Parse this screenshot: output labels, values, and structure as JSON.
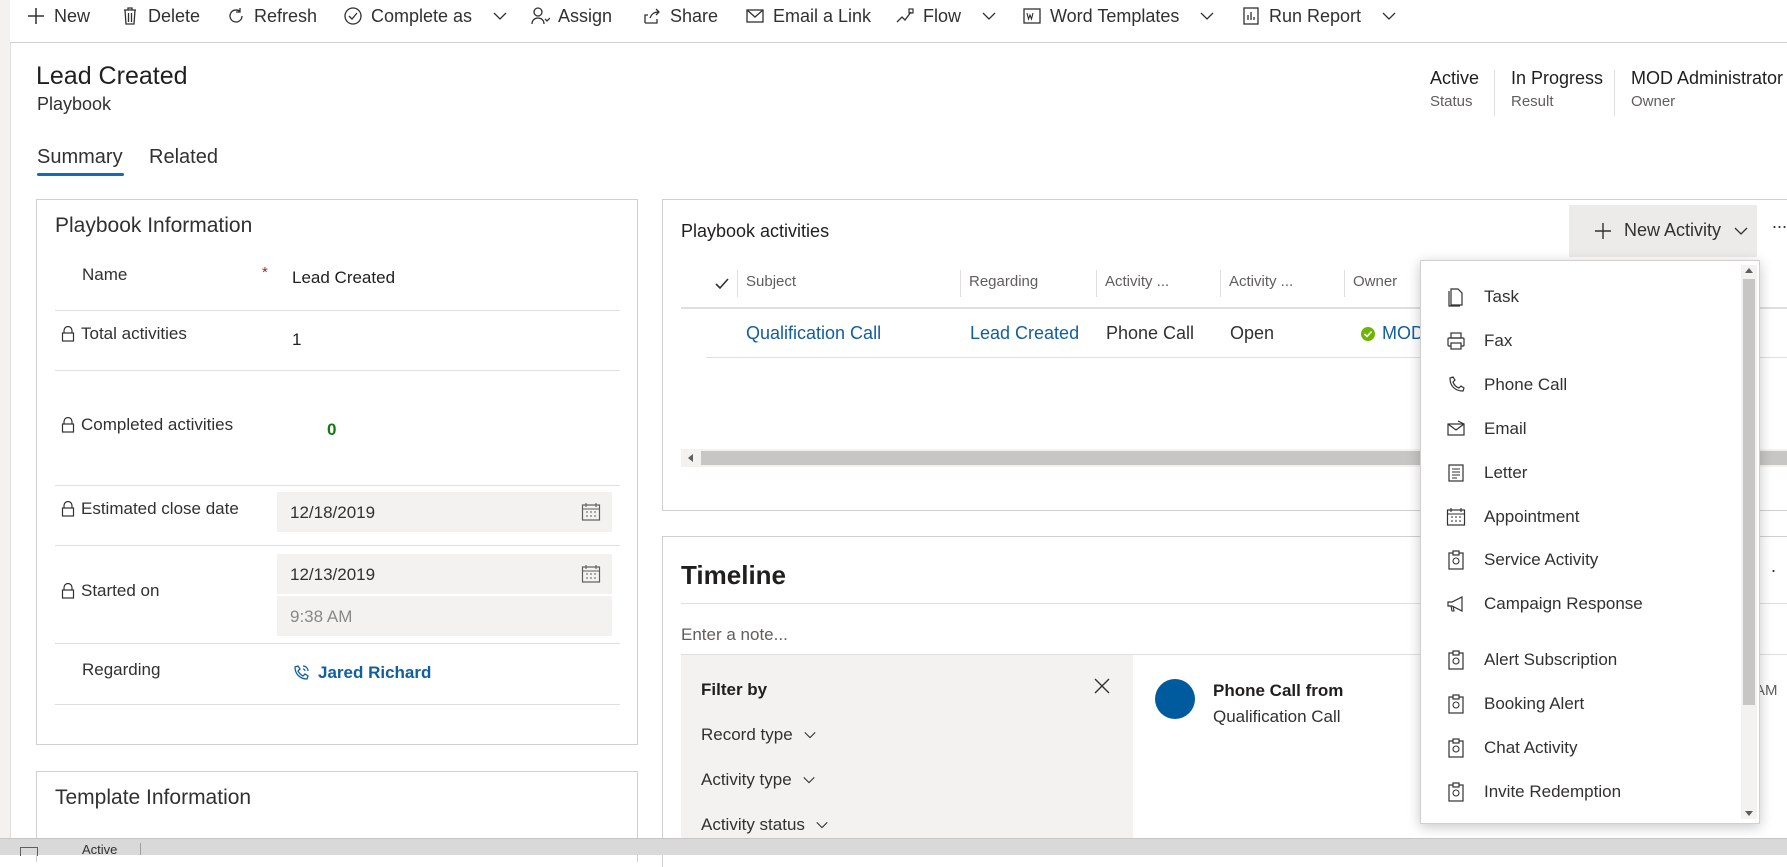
{
  "command_bar": {
    "new": "New",
    "delete": "Delete",
    "refresh": "Refresh",
    "complete_as": "Complete as",
    "assign": "Assign",
    "share": "Share",
    "email_link": "Email a Link",
    "flow": "Flow",
    "word_templates": "Word Templates",
    "run_report": "Run Report"
  },
  "header": {
    "title": "Lead Created",
    "entity": "Playbook",
    "fields": [
      {
        "value": "Active",
        "label": "Status"
      },
      {
        "value": "In Progress",
        "label": "Result"
      },
      {
        "value": "MOD Administrator",
        "label": "Owner"
      }
    ]
  },
  "tabs": [
    "Summary",
    "Related"
  ],
  "playbook_info": {
    "title": "Playbook Information",
    "name_label": "Name",
    "name_required": "*",
    "name_value": "Lead Created",
    "total_label": "Total activities",
    "total_value": "1",
    "completed_label": "Completed activities",
    "completed_value": "0",
    "est_close_label": "Estimated close date",
    "est_close_value": "12/18/2019",
    "started_label": "Started on",
    "started_date": "12/13/2019",
    "started_time": "9:38 AM",
    "regarding_label": "Regarding",
    "regarding_value": "Jared Richard"
  },
  "template_info": {
    "title": "Template Information"
  },
  "activities": {
    "title": "Playbook activities",
    "new_activity": "New Activity",
    "more": "...",
    "columns": [
      "Subject",
      "Regarding",
      "Activity ...",
      "Activity ...",
      "Owner"
    ],
    "row": {
      "subject": "Qualification Call",
      "regarding": "Lead Created",
      "type": "Phone Call",
      "status": "Open",
      "owner": "MOD"
    }
  },
  "timeline": {
    "title": "Timeline",
    "note_placeholder": "Enter a note...",
    "filter_title": "Filter by",
    "filters": [
      "Record type",
      "Activity type",
      "Activity status"
    ],
    "item_title": "Phone Call from",
    "item_sub": "Qualification Call",
    "item_time_fragment": "AM"
  },
  "new_activity_menu": [
    {
      "label": "Task",
      "icon": "task-icon"
    },
    {
      "label": "Fax",
      "icon": "fax-icon"
    },
    {
      "label": "Phone Call",
      "icon": "phone-icon"
    },
    {
      "label": "Email",
      "icon": "email-icon"
    },
    {
      "label": "Letter",
      "icon": "letter-icon"
    },
    {
      "label": "Appointment",
      "icon": "calendar-icon"
    },
    {
      "label": "Service Activity",
      "icon": "clipboard-icon"
    },
    {
      "label": "Campaign Response",
      "icon": "megaphone-icon"
    },
    {
      "label": "Alert Subscription",
      "icon": "clipboard-icon"
    },
    {
      "label": "Booking Alert",
      "icon": "clipboard-icon"
    },
    {
      "label": "Chat Activity",
      "icon": "clipboard-icon"
    },
    {
      "label": "Invite Redemption",
      "icon": "clipboard-icon"
    }
  ],
  "statusbar": {
    "text": "Active"
  },
  "colors": {
    "link": "#115ea3",
    "accent": "#0f6cbd",
    "success": "#107c10",
    "required": "#a4262c"
  }
}
